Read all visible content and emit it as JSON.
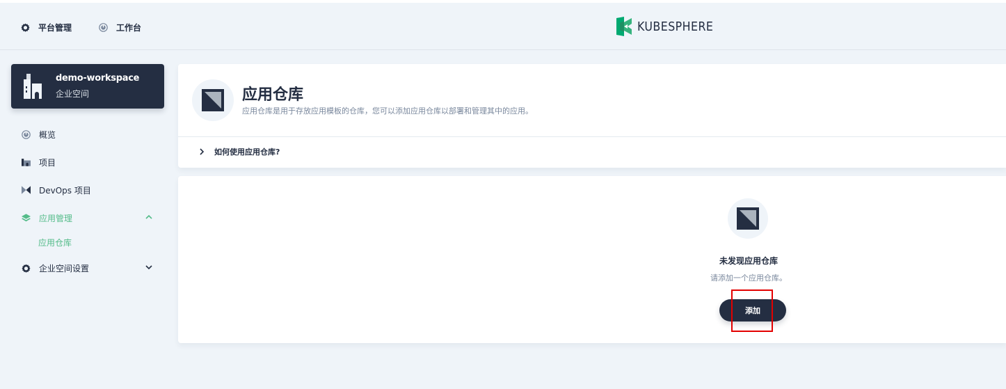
{
  "header": {
    "nav": [
      {
        "label": "平台管理",
        "icon": "gear-icon"
      },
      {
        "label": "工作台",
        "icon": "dashboard-icon"
      }
    ],
    "logo_text": "KUBESPHERE"
  },
  "workspace": {
    "name": "demo-workspace",
    "type_label": "企业空间"
  },
  "sidebar": {
    "items": [
      {
        "label": "概览",
        "icon": "dashboard-icon"
      },
      {
        "label": "项目",
        "icon": "project-icon"
      },
      {
        "label": "DevOps 项目",
        "icon": "devops-icon"
      },
      {
        "label": "应用管理",
        "icon": "app-layers-icon",
        "expanded": true
      },
      {
        "label": "企业空间设置",
        "icon": "gear-icon",
        "expanded": false
      }
    ],
    "sub_items": [
      {
        "label": "应用仓库",
        "active": true
      }
    ]
  },
  "page": {
    "title": "应用仓库",
    "description": "应用仓库是用于存放应用模板的仓库，您可以添加应用仓库以部署和管理其中的应用。",
    "howto_label": "如何使用应用仓库?"
  },
  "empty_state": {
    "title": "未发现应用仓库",
    "description": "请添加一个应用仓库。",
    "button_label": "添加"
  },
  "colors": {
    "accent": "#55bc8a",
    "dark": "#242e42",
    "background": "#eff4f9",
    "highlight": "#e30000"
  }
}
